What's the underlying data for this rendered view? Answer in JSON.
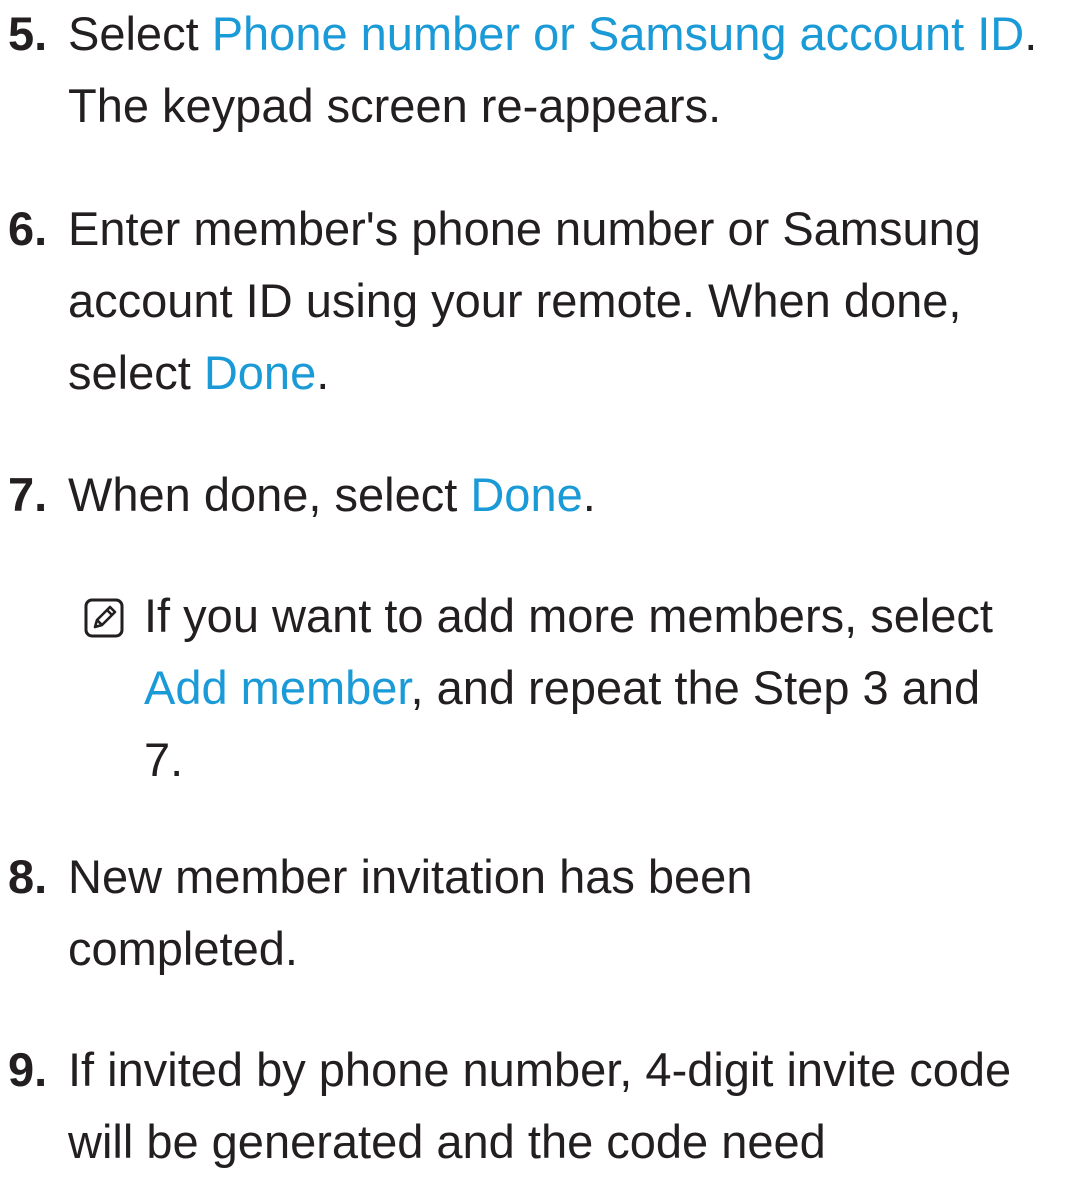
{
  "steps": [
    {
      "number": "5.",
      "parts": [
        "Select ",
        "Phone number or Samsung account ID",
        ". The keypad screen re-appears."
      ]
    },
    {
      "number": "6.",
      "parts": [
        "Enter member's phone number or Samsung account ID using your remote. When done, select ",
        "Done",
        "."
      ]
    },
    {
      "number": "7.",
      "parts": [
        "When done, select ",
        "Done",
        "."
      ]
    },
    {
      "number": "8.",
      "text": "New member invitation has been completed."
    },
    {
      "number": "9.",
      "text": "If invited by phone number, 4-digit invite code will be generated and the code need"
    }
  ],
  "note": {
    "icon": "note-icon",
    "parts": [
      "If you want to add more members, select ",
      "Add member",
      ", and repeat the Step 3 and 7."
    ]
  },
  "colors": {
    "text": "#231f20",
    "highlight": "#1a9ad6"
  }
}
